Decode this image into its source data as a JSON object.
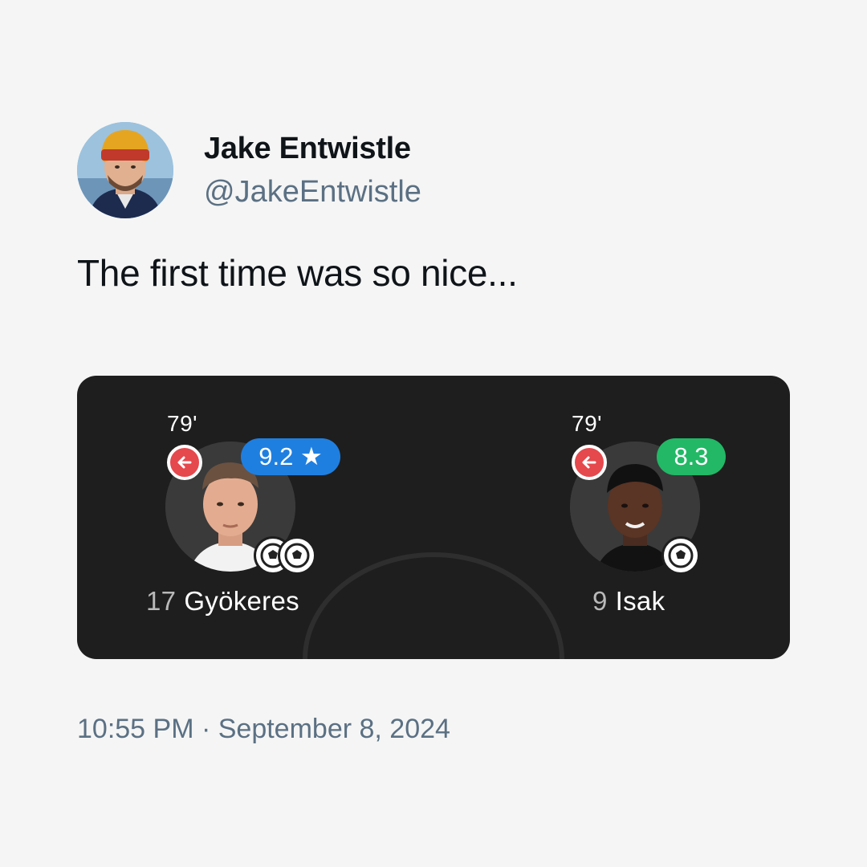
{
  "author": {
    "display_name": "Jake Entwistle",
    "handle": "@JakeEntwistle",
    "avatar_icon": "profile-photo"
  },
  "tweet": {
    "text": "The first time was so nice...",
    "timestamp": "10:55 PM · September 8, 2024"
  },
  "card": {
    "players": [
      {
        "minute": "79'",
        "rating": "9.2 ★",
        "rating_color": "#1f7fe0",
        "number": "17",
        "name": "Gyökeres",
        "goals": 2,
        "sub_icon": "substitution-off-icon"
      },
      {
        "minute": "79'",
        "rating": "8.3",
        "rating_color": "#22b866",
        "number": "9",
        "name": "Isak",
        "goals": 1,
        "sub_icon": "substitution-off-icon"
      }
    ]
  },
  "colors": {
    "background": "#f5f5f5",
    "card_background": "#1e1e1e",
    "secondary_text": "#5b7083",
    "sub_badge": "#e5484d"
  }
}
